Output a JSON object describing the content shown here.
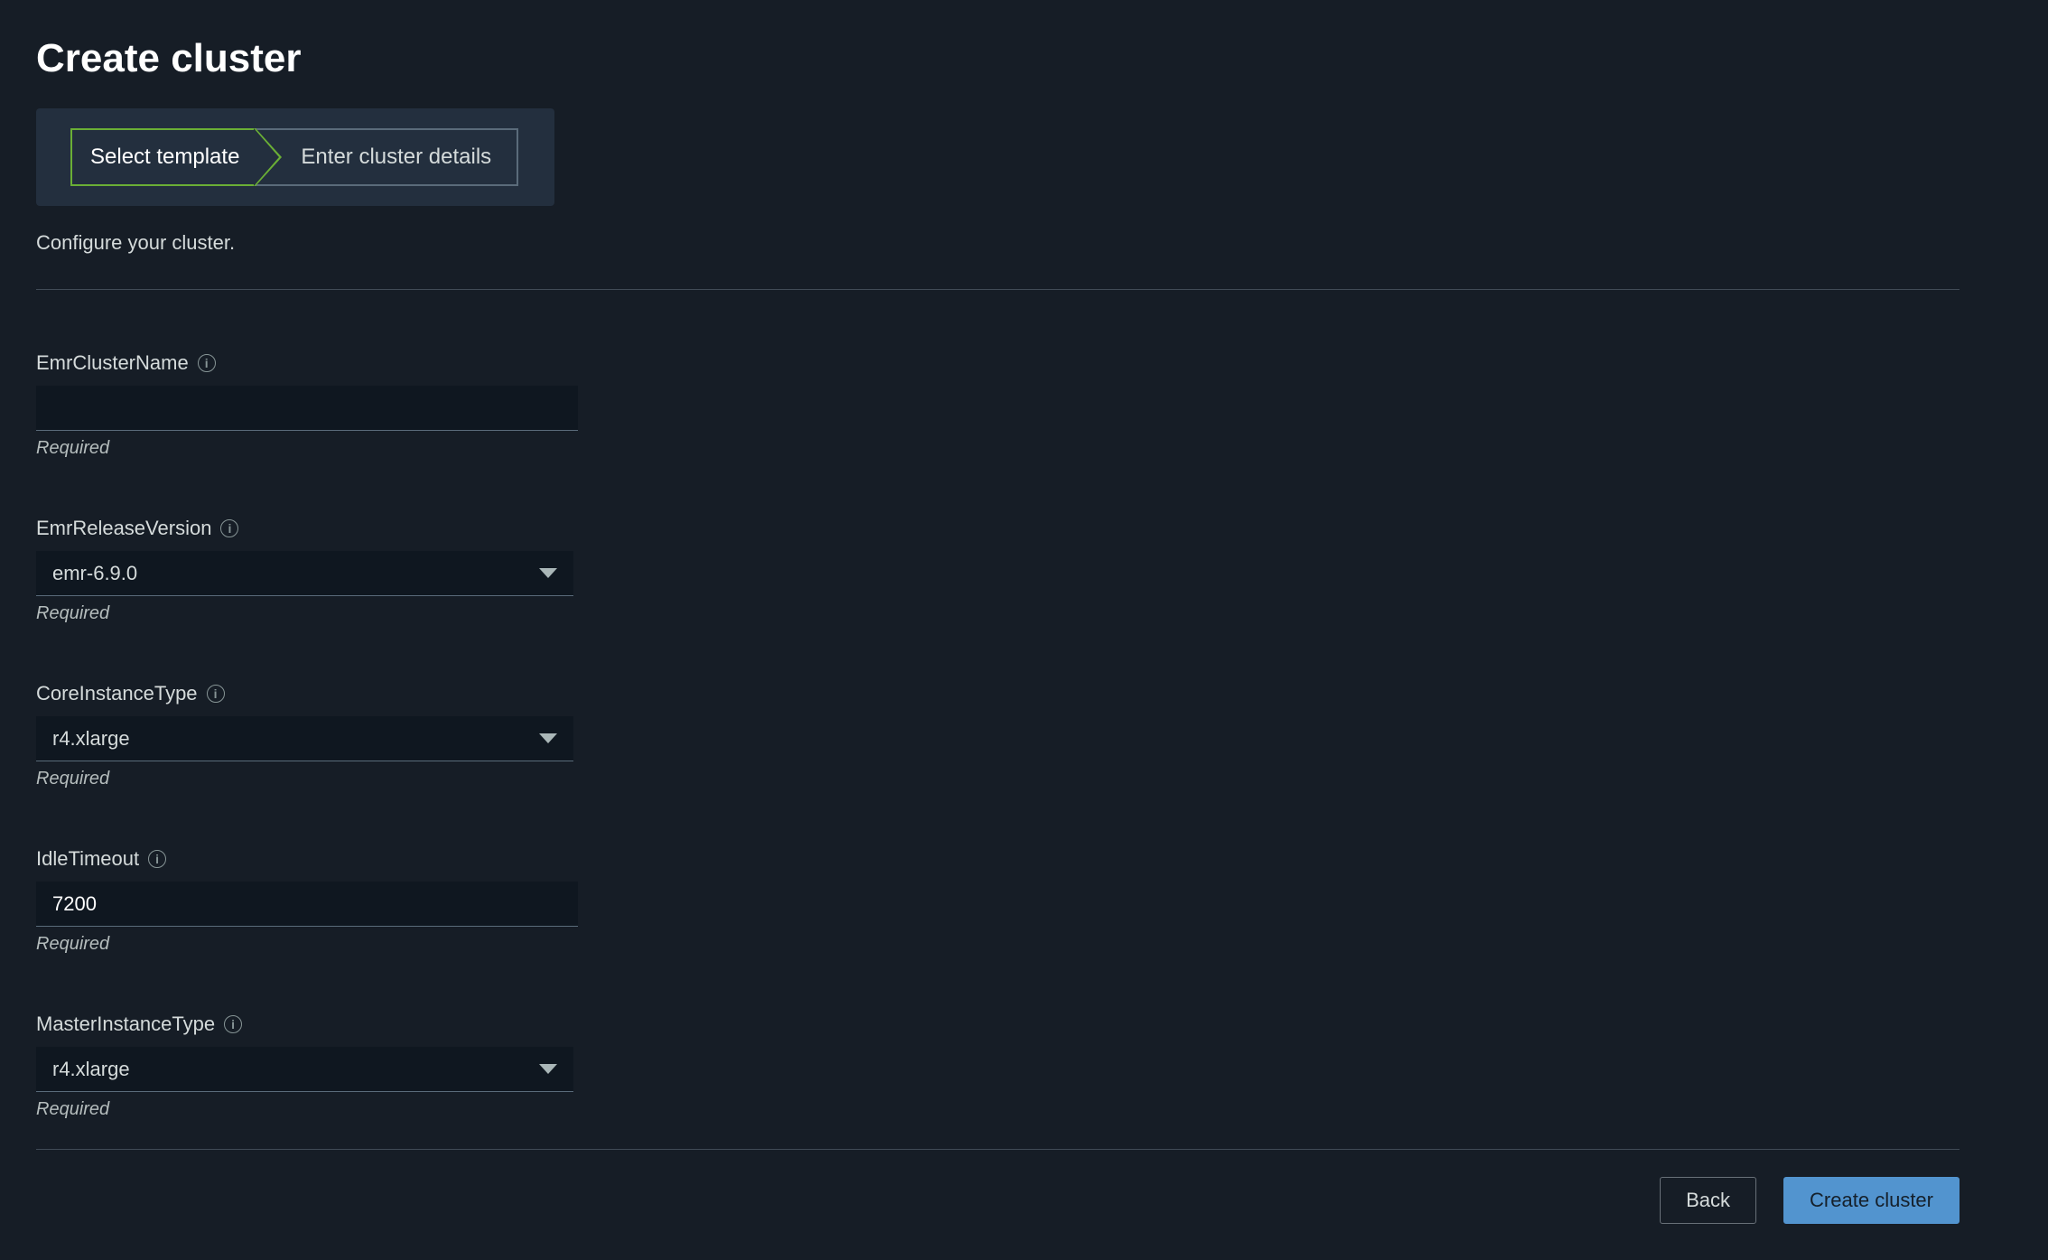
{
  "page": {
    "title": "Create cluster",
    "subtext": "Configure your cluster."
  },
  "wizard": {
    "step1": "Select template",
    "step2": "Enter cluster details"
  },
  "fields": {
    "clusterName": {
      "label": "EmrClusterName",
      "value": "",
      "helper": "Required"
    },
    "releaseVersion": {
      "label": "EmrReleaseVersion",
      "value": "emr-6.9.0",
      "helper": "Required"
    },
    "coreInstanceType": {
      "label": "CoreInstanceType",
      "value": "r4.xlarge",
      "helper": "Required"
    },
    "idleTimeout": {
      "label": "IdleTimeout",
      "value": "7200",
      "helper": "Required"
    },
    "masterInstanceType": {
      "label": "MasterInstanceType",
      "value": "r4.xlarge",
      "helper": "Required"
    }
  },
  "buttons": {
    "back": "Back",
    "create": "Create cluster"
  }
}
